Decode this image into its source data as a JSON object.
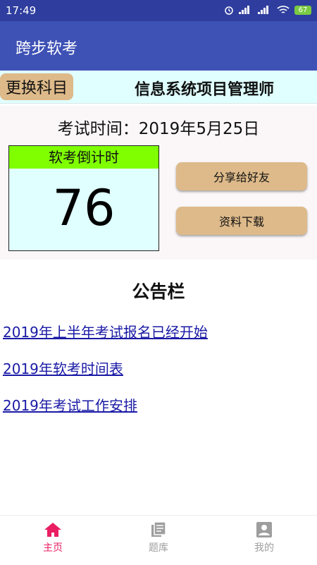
{
  "status_bar": {
    "time": "17:49",
    "battery": "67"
  },
  "app_bar": {
    "title": "跨步软考"
  },
  "subject_bar": {
    "change_button": "更换科目",
    "subject": "信息系统项目管理师"
  },
  "countdown": {
    "exam_date": "考试时间：2019年5月25日",
    "label": "软考倒计时",
    "days": "76",
    "share_button": "分享给好友",
    "download_button": "资料下载"
  },
  "notices": {
    "title": "公告栏",
    "items": [
      "2019年上半年考试报名已经开始",
      "2019年软考时间表",
      "2019年考试工作安排"
    ]
  },
  "bottom_nav": {
    "items": [
      {
        "label": "主页",
        "icon": "home-icon",
        "active": true
      },
      {
        "label": "题库",
        "icon": "question-bank-icon",
        "active": false
      },
      {
        "label": "我的",
        "icon": "profile-icon",
        "active": false
      }
    ]
  },
  "colors": {
    "status_bar": "#2f3e9e",
    "app_bar": "#3e51b5",
    "button": "#deba8a",
    "countdown_label": "#7fff00",
    "countdown_box": "#e0ffff",
    "active_nav": "#e91e63",
    "link": "#1a1aa6"
  }
}
